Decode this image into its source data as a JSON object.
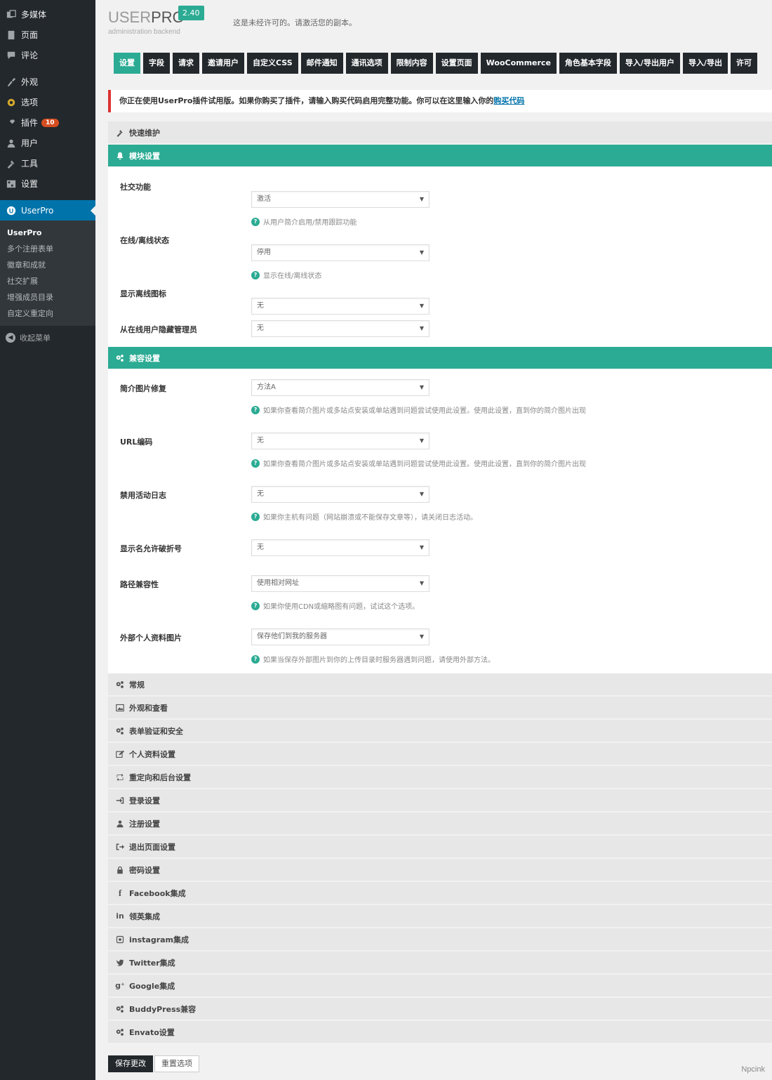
{
  "sidebar": {
    "items_top": [
      {
        "label": "多媒体",
        "icon": "media-icon"
      },
      {
        "label": "页面",
        "icon": "page-icon"
      },
      {
        "label": "评论",
        "icon": "comment-icon"
      }
    ],
    "items_mid": [
      {
        "label": "外观",
        "icon": "appearance-icon"
      },
      {
        "label": "选项",
        "icon": "options-gear-icon"
      },
      {
        "label": "插件",
        "icon": "plugins-icon",
        "badge": "10"
      },
      {
        "label": "用户",
        "icon": "users-icon"
      },
      {
        "label": "工具",
        "icon": "tools-icon"
      },
      {
        "label": "设置",
        "icon": "settings-icon"
      }
    ],
    "active": {
      "label": "UserPro",
      "icon": "userpro-icon"
    },
    "submenu": [
      "UserPro",
      "多个注册表单",
      "徽章和成就",
      "社交扩展",
      "增强成员目录",
      "自定义重定向"
    ],
    "collapse_label": "收起菜单"
  },
  "header": {
    "logo_user": "USER",
    "logo_pro": "PRO",
    "logo_sub": "administration backend",
    "version": "2.40",
    "unlicensed_text": "这是未经许可的。请激活您的副本。"
  },
  "tabs": [
    "设置",
    "字段",
    "请求",
    "邀请用户",
    "自定义CSS",
    "邮件通知",
    "通讯选项",
    "限制内容",
    "设置页面",
    "WooCommerce",
    "角色基本字段",
    "导入/导出用户",
    "导入/导出",
    "许可"
  ],
  "notice": {
    "text": "你正在使用UserPro插件试用版。如果你购买了插件，请输入购买代码启用完整功能。你可以在这里输入你的",
    "link": "购买代码"
  },
  "sections": {
    "quick": "快速维护",
    "modules": "模块设置",
    "compat": "兼容设置"
  },
  "module_settings": [
    {
      "label": "社交功能",
      "value": "激活",
      "help": "从用户简介启用/禁用跟踪功能"
    },
    {
      "label": "在线/离线状态",
      "value": "停用",
      "help": "显示在线/离线状态"
    },
    {
      "label": "显示离线图标",
      "value": "无",
      "help": ""
    },
    {
      "label": "从在线用户隐藏管理员",
      "value": "无",
      "help": ""
    }
  ],
  "compat_settings": [
    {
      "label": "简介图片修复",
      "value": "方法A",
      "help": "如果你查看简介图片或多站点安装或单站遇到问题尝试使用此设置。使用此设置，直到你的简介图片出现"
    },
    {
      "label": "URL编码",
      "value": "无",
      "help": "如果你查看简介图片或多站点安装或单站遇到问题尝试使用此设置。使用此设置，直到你的简介图片出现"
    },
    {
      "label": "禁用活动日志",
      "value": "无",
      "help": "如果你主机有问题（网站崩溃或不能保存文章等），请关闭日志活动。"
    },
    {
      "label": "显示名允许破折号",
      "value": "无",
      "help": ""
    },
    {
      "label": "路径兼容性",
      "value": "使用相对网址",
      "help": "如果你使用CDN或缩略图有问题，试试这个选项。"
    },
    {
      "label": "外部个人资料图片",
      "value": "保存他们到我的服务器",
      "help": "如果当保存外部图片到你的上传目录时服务器遇到问题，请使用外部方法。"
    }
  ],
  "collapsed_sections": [
    {
      "label": "常规",
      "icon": "gears-icon"
    },
    {
      "label": "外观和查看",
      "icon": "image-icon"
    },
    {
      "label": "表单验证和安全",
      "icon": "gears-icon"
    },
    {
      "label": "个人资料设置",
      "icon": "edit-icon"
    },
    {
      "label": "重定向和后台设置",
      "icon": "retweet-icon"
    },
    {
      "label": "登录设置",
      "icon": "sign-in-icon"
    },
    {
      "label": "注册设置",
      "icon": "user-icon"
    },
    {
      "label": "退出页面设置",
      "icon": "sign-out-icon"
    },
    {
      "label": "密码设置",
      "icon": "lock-icon"
    },
    {
      "label": "Facebook集成",
      "icon": "facebook-icon"
    },
    {
      "label": "领英集成",
      "icon": "linkedin-icon"
    },
    {
      "label": "instagram集成",
      "icon": "instagram-icon"
    },
    {
      "label": "Twitter集成",
      "icon": "twitter-icon"
    },
    {
      "label": "Google集成",
      "icon": "google-plus-icon"
    },
    {
      "label": "BuddyPress兼容",
      "icon": "gears-icon"
    },
    {
      "label": "Envato设置",
      "icon": "gears-icon"
    }
  ],
  "buttons": {
    "save": "保存更改",
    "reset": "重置选项"
  },
  "watermark": "Npcink",
  "colors": {
    "accent": "#2bab93",
    "sidebar": "#23282d",
    "active": "#0073aa",
    "notice_border": "#dc3232"
  }
}
